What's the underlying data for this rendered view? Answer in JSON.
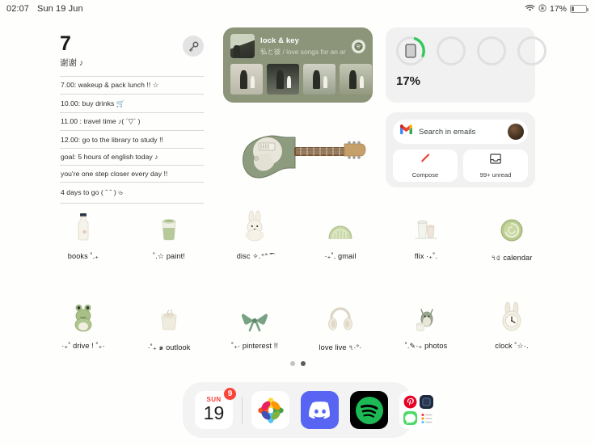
{
  "status_bar": {
    "time": "02:07",
    "date": "Sun 19 Jun",
    "wifi_icon": "wifi-icon",
    "lock_icon": "rotation-lock-icon",
    "battery_percent": "17%"
  },
  "notes_widget": {
    "number": "7",
    "subtitle": "谢谢 ♪",
    "key_icon": "key-icon",
    "items": [
      "7.00: wakeup & pack lunch !! ☆",
      "10.00: buy drinks 🛒",
      "11.00 : travel time ♪( ´▽` )",
      "12.00: go to the library to study !!",
      "goal: 5 hours of english today ♪",
      "you're one step closer every day !!",
      "4 days to go ( ˆ ˆ ) ৬"
    ]
  },
  "music_widget": {
    "title": "lock & key",
    "artist": "私と彼 / love songs for an angel",
    "service_icon": "spotify-icon",
    "album_count": 4
  },
  "guitar_widget": {
    "name": "electric-guitar-photo",
    "body_color": "#8d9b7e",
    "neck_color": "#7a5230"
  },
  "battery_widget": {
    "percent": "17%",
    "device_icon": "ipad-icon",
    "ring_count": 4,
    "accent_color": "#34c759",
    "fill_ratio": 0.17
  },
  "gmail_widget": {
    "logo_icon": "gmail-icon",
    "search_placeholder": "Search in emails",
    "avatar": "user-avatar",
    "compose": {
      "icon": "pencil-icon",
      "label": "Compose"
    },
    "unread": {
      "icon": "inbox-icon",
      "label": "99+ unread"
    }
  },
  "apps": {
    "row1": [
      {
        "label": "books ˚.₊",
        "icon": "milk-bottle-icon"
      },
      {
        "label": "˚.☆ paint!",
        "icon": "matcha-cup-icon"
      },
      {
        "label": "disc ✧.⁺°  ͡˜",
        "icon": "bunny-plush-icon"
      },
      {
        "label": "·₊˚. gmail",
        "icon": "melon-slice-icon"
      },
      {
        "label": "flix ·₊˚.",
        "icon": "glass-cups-icon"
      },
      {
        "label": "৭৫ calendar",
        "icon": "matcha-swirl-icon"
      }
    ],
    "row2": [
      {
        "label": "·₊˚ drive ! ˚₊·",
        "icon": "frog-plush-icon"
      },
      {
        "label": "·˚₊ ๑ outlook",
        "icon": "latte-cup-icon"
      },
      {
        "label": "˚₊· pinterest !!",
        "icon": "green-bow-icon"
      },
      {
        "label": "love live ৭·°·",
        "icon": "headphones-icon"
      },
      {
        "label": "˚.✎·₊ photos",
        "icon": "totoro-cup-icon"
      },
      {
        "label": "clock ˚☆·.",
        "icon": "bunny-clock-icon"
      }
    ]
  },
  "page_dots": {
    "count": 2,
    "active_index": 1
  },
  "dock": {
    "items": [
      {
        "name": "calendar",
        "weekday": "SUN",
        "day": "19",
        "badge": "9"
      },
      {
        "name": "photos"
      },
      {
        "name": "discord"
      },
      {
        "name": "spotify"
      },
      {
        "name": "social-folder"
      }
    ]
  },
  "colors": {
    "background": "#fefefd",
    "music_widget_bg": "#8c9479",
    "widget_bg": "#f1f1f1",
    "spotify_green": "#1db954",
    "discord_blurple": "#5865f2",
    "badge_red": "#f9443a"
  }
}
